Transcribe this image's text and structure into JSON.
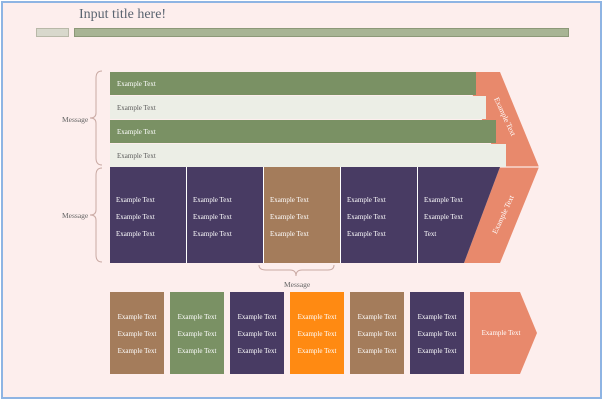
{
  "title": "Input title here!",
  "colors": {
    "green": "#7a9164",
    "light": "#eceee6",
    "purple": "#483b63",
    "tan": "#a47c5b",
    "orange": "#ff8a12",
    "salmon": "#e8896c"
  },
  "top_rows": [
    "Example Text",
    "Example Text",
    "Example Text",
    "Example Text"
  ],
  "grid_cells": [
    [
      "Example Text",
      "Example Text",
      "Example Text"
    ],
    [
      "Example Text",
      "Example Text",
      "Example Text"
    ],
    [
      "Example Text",
      "Example Text",
      "Example Text"
    ],
    [
      "Example Text",
      "Example Text",
      "Example Text"
    ],
    [
      "Example Text",
      "Example Text",
      "Text"
    ]
  ],
  "arrow_top_text": "Example Text",
  "arrow_bottom_text": "Example Text",
  "message_labels": [
    "Message",
    "Message",
    "Message"
  ],
  "bottom_boxes": [
    [
      "Example Text",
      "Example Text",
      "Example Text"
    ],
    [
      "Example Text",
      "Example Text",
      "Example Text"
    ],
    [
      "Example Text",
      "Example Text",
      "Example Text"
    ],
    [
      "Example Text",
      "Example Text",
      "Example Text"
    ],
    [
      "Example Text",
      "Example Text",
      "Example Text"
    ],
    [
      "Example Text",
      "Example Text",
      "Example Text"
    ]
  ],
  "bottom_arrow_text": "Example Text"
}
